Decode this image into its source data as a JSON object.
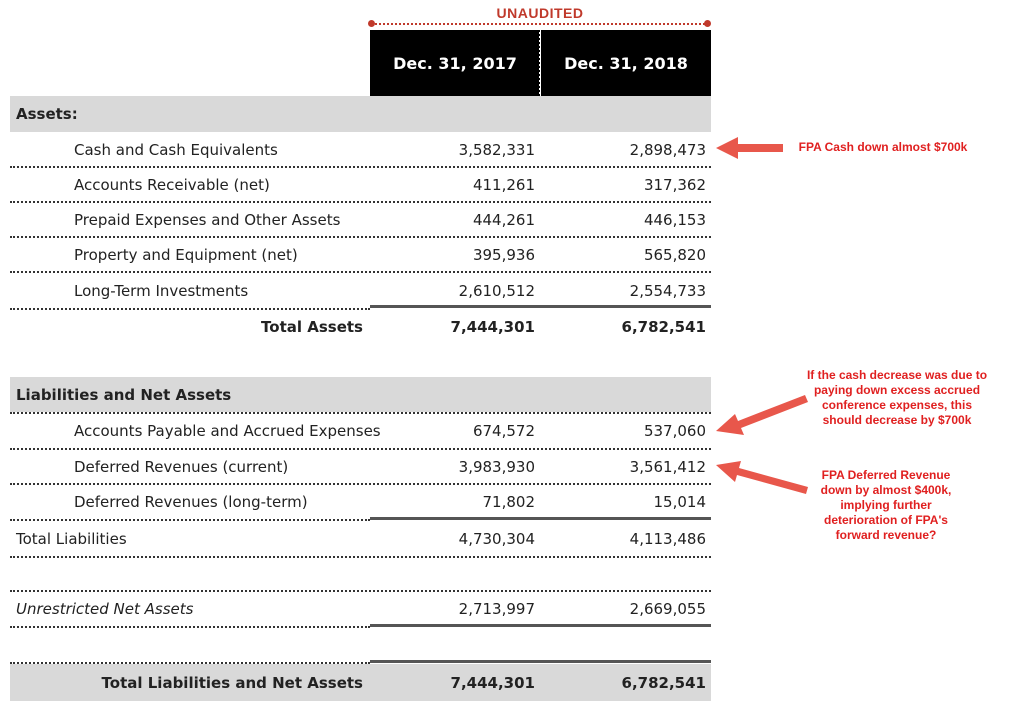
{
  "header": {
    "unaudited": "UNAUDITED",
    "columns": [
      "Dec. 31, 2017",
      "Dec. 31, 2018"
    ]
  },
  "assets": {
    "title": "Assets:",
    "rows": [
      {
        "label": "Cash and Cash Equivalents",
        "v2017": "3,582,331",
        "v2018": "2,898,473"
      },
      {
        "label": "Accounts Receivable (net)",
        "v2017": "411,261",
        "v2018": "317,362"
      },
      {
        "label": "Prepaid Expenses and Other Assets",
        "v2017": "444,261",
        "v2018": "446,153"
      },
      {
        "label": "Property and Equipment (net)",
        "v2017": "395,936",
        "v2018": "565,820"
      },
      {
        "label": "Long-Term Investments",
        "v2017": "2,610,512",
        "v2018": "2,554,733"
      }
    ],
    "total": {
      "label": "Total Assets",
      "v2017": "7,444,301",
      "v2018": "6,782,541"
    }
  },
  "liabilities": {
    "title": "Liabilities and Net Assets",
    "rows": [
      {
        "label": "Accounts Payable and Accrued Expenses",
        "v2017": "674,572",
        "v2018": "537,060"
      },
      {
        "label": "Deferred Revenues (current)",
        "v2017": "3,983,930",
        "v2018": "3,561,412"
      },
      {
        "label": "Deferred Revenues (long-term)",
        "v2017": "71,802",
        "v2018": "15,014"
      }
    ],
    "total": {
      "label": "Total Liabilities",
      "v2017": "4,730,304",
      "v2018": "4,113,486"
    }
  },
  "net_assets": {
    "label": "Unrestricted Net Assets",
    "v2017": "2,713,997",
    "v2018": "2,669,055"
  },
  "grand_total": {
    "label": "Total Liabilities and Net Assets",
    "v2017": "7,444,301",
    "v2018": "6,782,541"
  },
  "annotations": {
    "cash_note": "FPA Cash down almost $700k",
    "payable_note": "If the cash decrease was due to paying down excess accrued conference expenses, this should decrease by $700k",
    "deferred_note": "FPA Deferred Revenue down by almost $400k, implying further deterioration of FPA's forward revenue?"
  },
  "colors": {
    "accent": "#e02020",
    "header_bg": "#000000",
    "section_bg": "#d9d9d9",
    "bracket": "#c0392b"
  }
}
